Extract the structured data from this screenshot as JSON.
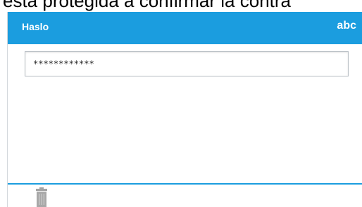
{
  "caption": "esta protegida a confirmar la contra",
  "dialog": {
    "title": "Haslo",
    "input_mode": "abc",
    "password_value": "************"
  },
  "footer": {
    "delete_icon": "trash-icon"
  },
  "colors": {
    "header_bg": "#1b9ddf",
    "footer_line": "#1b9ddf",
    "icon_gray": "#9a9a9a"
  }
}
